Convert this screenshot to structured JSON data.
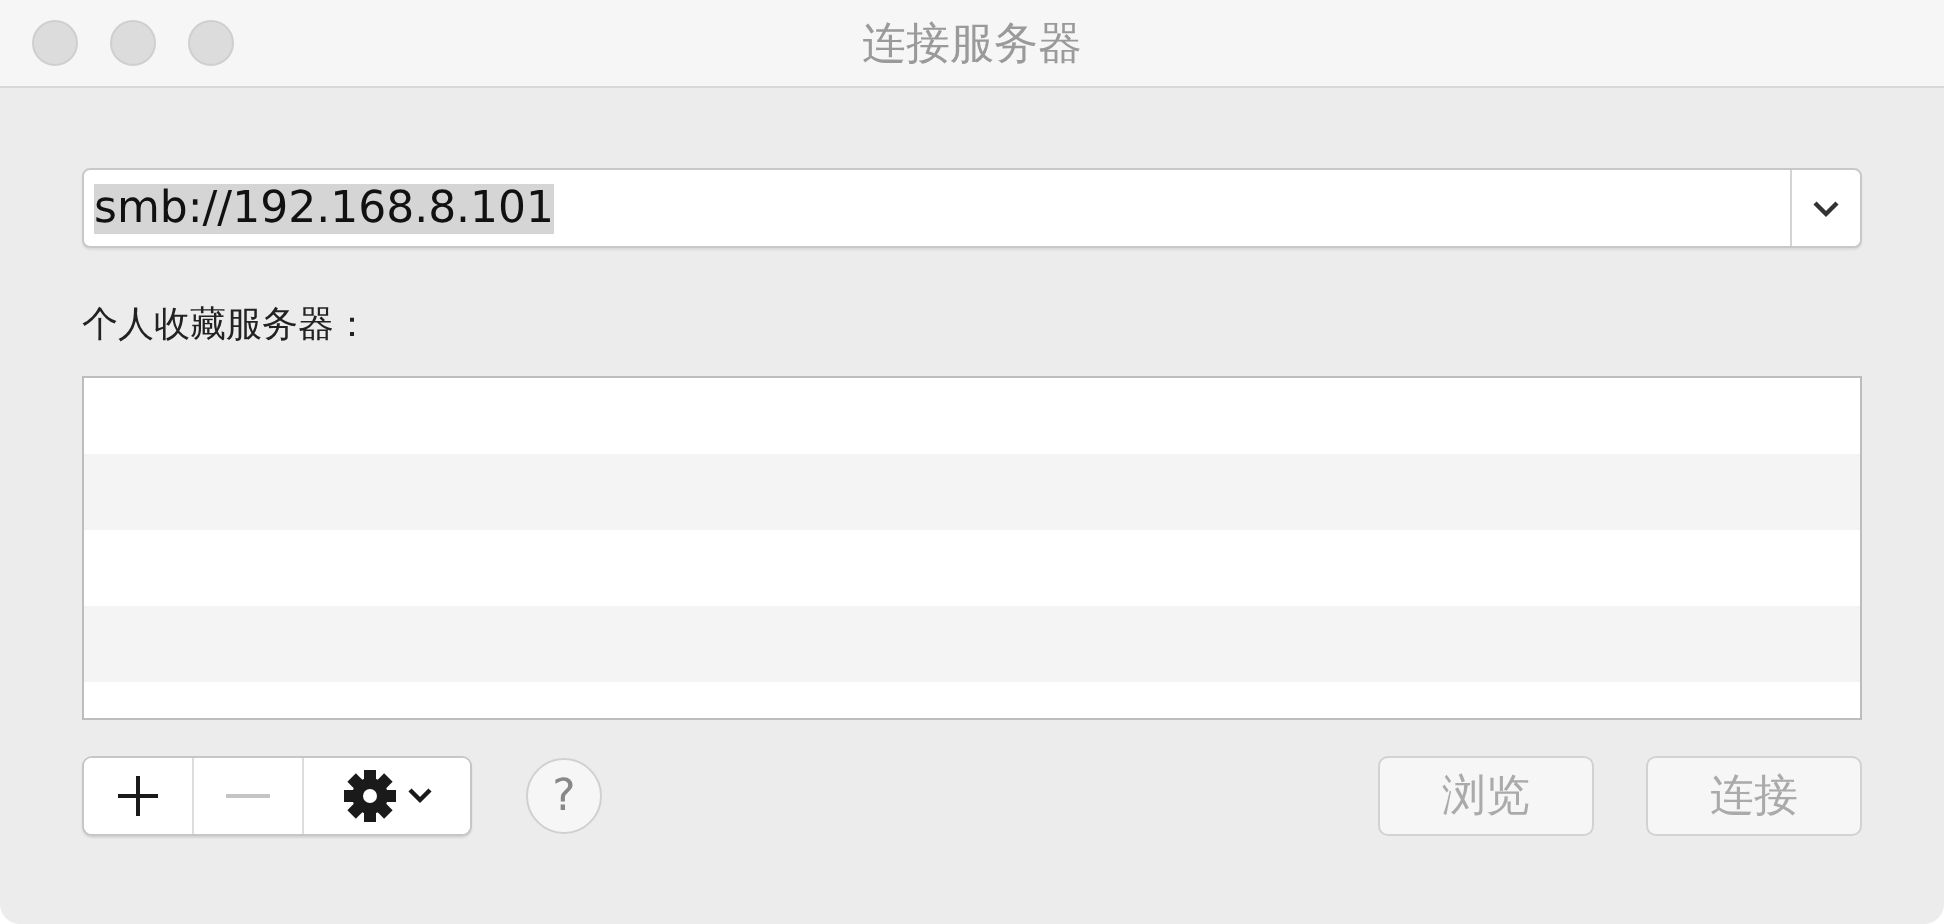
{
  "window": {
    "title": "连接服务器"
  },
  "address": {
    "value": "smb://192.168.8.101",
    "text_selected": true
  },
  "favorites": {
    "label": "个人收藏服务器："
  },
  "list_tools": [
    {
      "kind": "add",
      "disabled": false
    },
    {
      "kind": "remove",
      "disabled": true
    },
    {
      "kind": "action",
      "disabled": false
    }
  ],
  "help": {
    "label": "?"
  },
  "buttons": [
    {
      "label": "浏览",
      "disabled": true
    },
    {
      "label": "连接",
      "disabled": true
    }
  ]
}
